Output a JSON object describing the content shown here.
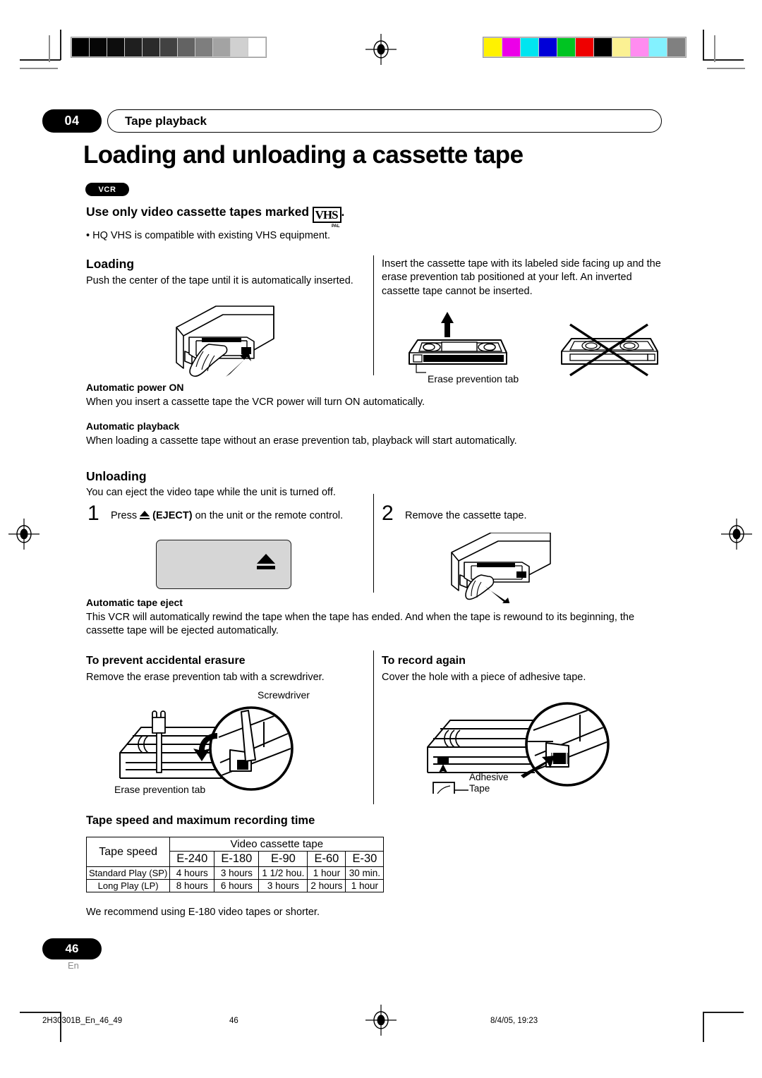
{
  "print_marks": {
    "gray_wedge": [
      "#000000",
      "#060606",
      "#0d0d0d",
      "#1f1f1f",
      "#2b2b2b",
      "#424242",
      "#636363",
      "#7e7e7e",
      "#a3a3a3",
      "#d0d0d0",
      "#ffffff"
    ],
    "color_bar": [
      "#fff200",
      "#ec00e8",
      "#00e5f0",
      "#0000d8",
      "#00c422",
      "#ef0000",
      "#000000",
      "#fbf193",
      "#ff8cf0",
      "#83f1ff",
      "#808080"
    ]
  },
  "header": {
    "chapter_number": "04",
    "chapter_title": "Tape playback",
    "page_title": "Loading and unloading a cassette tape",
    "device_badge": "VCR"
  },
  "intro": {
    "heading_prefix": "Use only video cassette tapes marked",
    "vhs_logo_text": "VHS",
    "vhs_logo_sub": "PAL",
    "heading_suffix": ".",
    "bullet": "• HQ VHS is compatible with existing VHS equipment."
  },
  "loading": {
    "heading": "Loading",
    "body": "Push the center of the tape until it is automatically inserted.",
    "right_body": "Insert the cassette tape with its labeled side facing up and the erase prevention tab positioned at your left. An inverted cassette tape cannot be inserted.",
    "erase_tab_caption": "Erase prevention tab"
  },
  "auto_power": {
    "heading": "Automatic power ON",
    "body": "When you insert a cassette tape the VCR power will turn ON automatically."
  },
  "auto_playback": {
    "heading": "Automatic playback",
    "body": "When loading a cassette tape without an erase prevention tab, playback will start automatically."
  },
  "unloading": {
    "heading": "Unloading",
    "body": "You can eject the video tape while the unit is turned off.",
    "steps": [
      {
        "num": "1",
        "text_before": "Press",
        "eject_label": "(EJECT)",
        "text_after": "on the unit or the remote control."
      },
      {
        "num": "2",
        "text": "Remove the cassette tape."
      }
    ]
  },
  "auto_eject": {
    "heading": "Automatic tape eject",
    "body": "This VCR will automatically rewind the tape when the tape has ended. And when the tape is rewound to its beginning, the cassette tape will be ejected automatically."
  },
  "prevent_erasure": {
    "heading": "To prevent accidental erasure",
    "body": "Remove the erase prevention tab with a screwdriver.",
    "label_screwdriver": "Screwdriver",
    "label_tab": "Erase prevention tab"
  },
  "record_again": {
    "heading": "To record again",
    "body": "Cover the hole with a piece of adhesive tape.",
    "label_adhesive_line1": "Adhesive",
    "label_adhesive_line2": "Tape"
  },
  "tape_table": {
    "heading": "Tape speed and maximum recording time",
    "corner_label": "Tape speed",
    "group_header": "Video cassette tape",
    "columns": [
      "E-240",
      "E-180",
      "E-90",
      "E-60",
      "E-30"
    ],
    "rows": [
      {
        "label": "Standard Play (SP)",
        "values": [
          "4 hours",
          "3 hours",
          "1 1/2 hou.",
          "1 hour",
          "30 min."
        ]
      },
      {
        "label": "Long Play (LP)",
        "values": [
          "8 hours",
          "6 hours",
          "3 hours",
          "2 hours",
          "1 hour"
        ]
      }
    ],
    "recommendation": "We recommend using E-180 video tapes or shorter."
  },
  "footer": {
    "page_number": "46",
    "language": "En",
    "file_id": "2H30301B_En_46_49",
    "folio": "46",
    "timestamp": "8/4/05, 19:23"
  }
}
